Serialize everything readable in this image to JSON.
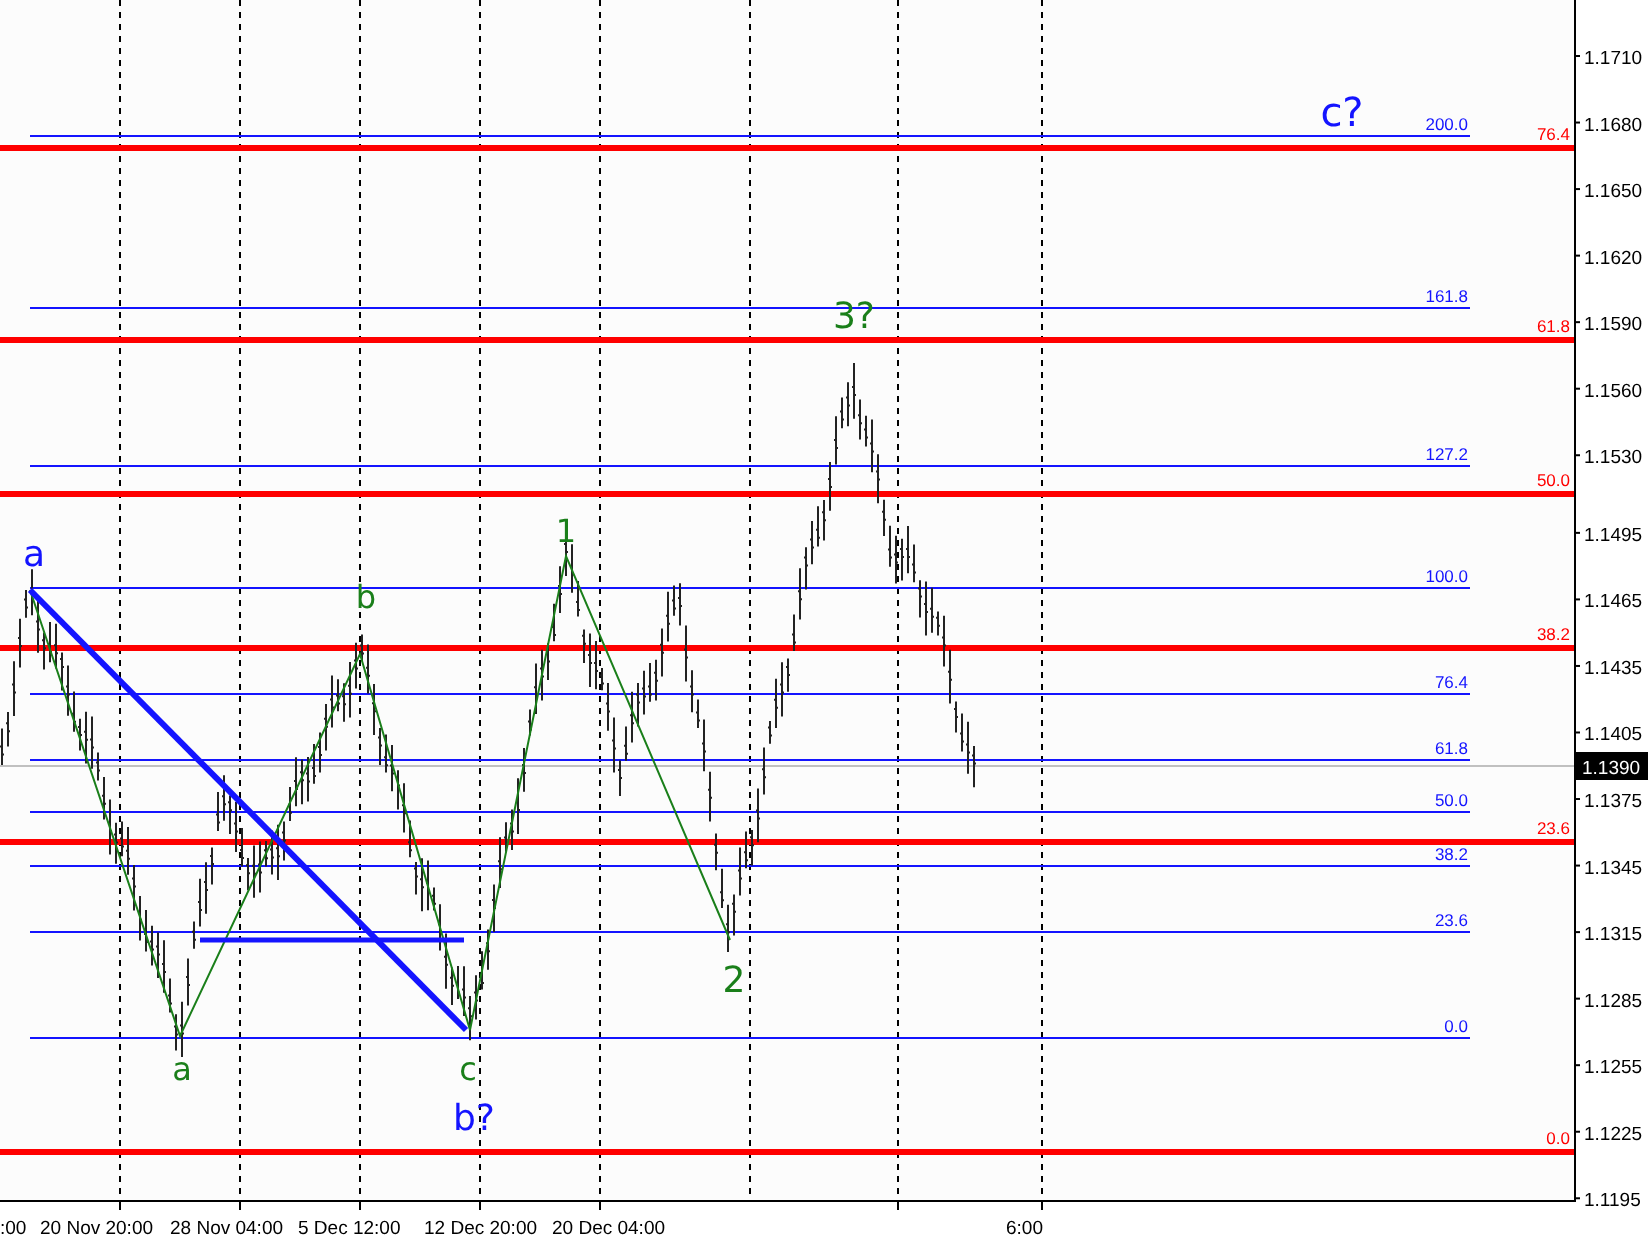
{
  "price_axis": {
    "ticks": [
      "1.1710",
      "1.1680",
      "1.1650",
      "1.1620",
      "1.1590",
      "1.1560",
      "1.1530",
      "1.1495",
      "1.1465",
      "1.1435",
      "1.1405",
      "1.1375",
      "1.1345",
      "1.1315",
      "1.1285",
      "1.1255",
      "1.1225",
      "1.1195"
    ],
    "current_price": "1.1390"
  },
  "time_axis": {
    "labels": [
      ":00",
      "20 Nov 20:00",
      "28 Nov 04:00",
      "5 Dec 12:00",
      "12 Dec 20:00",
      "20 Dec 04:00",
      "6:00"
    ]
  },
  "fib_expansion_levels": [
    "200.0",
    "161.8",
    "127.2",
    "100.0",
    "76.4",
    "61.8",
    "50.0",
    "38.2",
    "23.6",
    "0.0"
  ],
  "fib_retracement_levels": [
    "76.4",
    "61.8",
    "50.0",
    "38.2",
    "23.6",
    "0.0"
  ],
  "waves": [
    {
      "label": "a",
      "color": "#1414ff"
    },
    {
      "label": "a",
      "color": "#1a7f1a"
    },
    {
      "label": "b",
      "color": "#1a7f1a"
    },
    {
      "label": "c",
      "color": "#1a7f1a"
    },
    {
      "label": "b?",
      "color": "#1414ff"
    },
    {
      "label": "1",
      "color": "#1a7f1a"
    },
    {
      "label": "2",
      "color": "#1a7f1a"
    },
    {
      "label": "3?",
      "color": "#1a7f1a"
    },
    {
      "label": "c?",
      "color": "#1414ff"
    }
  ]
}
